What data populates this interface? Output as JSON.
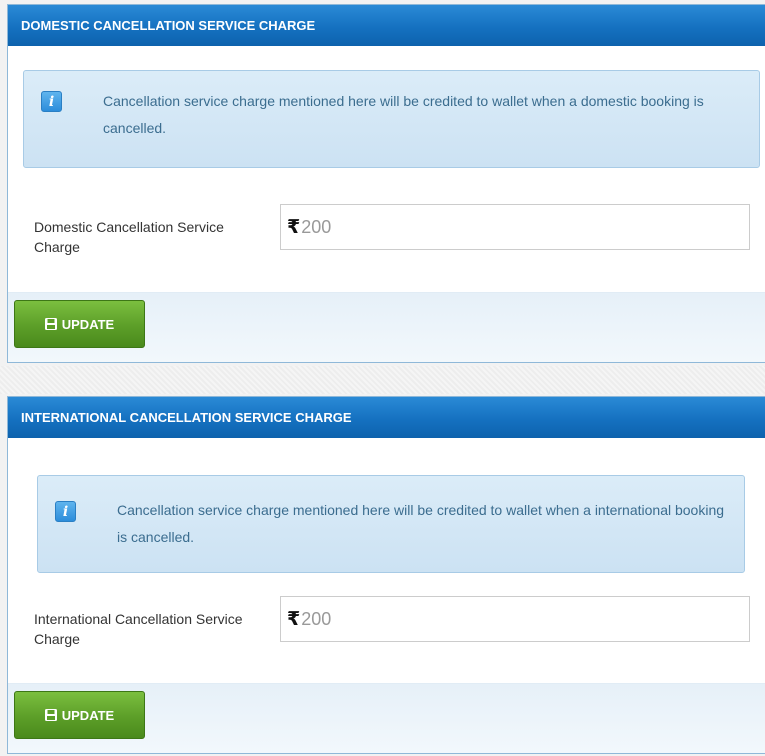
{
  "domestic": {
    "header_title": "DOMESTIC CANCELLATION SERVICE CHARGE",
    "info_icon_glyph": "i",
    "info_text": "Cancellation service charge mentioned here will be credited to wallet when a domestic booking is cancelled.",
    "field_label": "Domestic Cancellation Service Charge",
    "currency_symbol": "₹",
    "value": "200",
    "button_label": "UPDATE"
  },
  "international": {
    "header_title": "INTERNATIONAL CANCELLATION SERVICE CHARGE",
    "info_icon_glyph": "i",
    "info_text": "Cancellation service charge mentioned here will be credited to wallet when a international booking is cancelled.",
    "field_label": "International Cancellation Service Charge",
    "currency_symbol": "₹",
    "value": "200",
    "button_label": "UPDATE"
  },
  "icons": {
    "info": "info-icon",
    "currency": "rupee-icon",
    "save": "floppy-disk-icon"
  },
  "colors": {
    "header": "#1571c0",
    "button": "#5c9e28",
    "info_box": "#cce2f3",
    "info_text": "#3b6d8f"
  }
}
